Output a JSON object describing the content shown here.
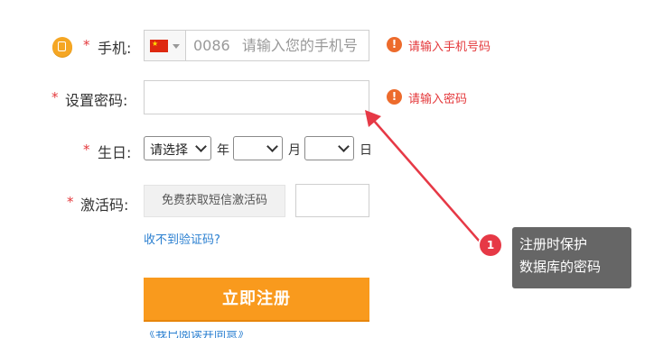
{
  "form": {
    "required_mark": "*",
    "phone": {
      "label": "手机:",
      "country_code": "0086",
      "placeholder": "请输入您的手机号",
      "error": "请输入手机号码",
      "error_icon": "!"
    },
    "password": {
      "label": "设置密码:",
      "error": "请输入密码",
      "error_icon": "!"
    },
    "birthday": {
      "label": "生日:",
      "year_select": "请选择",
      "year_unit": "年",
      "month_unit": "月",
      "day_unit": "日"
    },
    "activation": {
      "label": "激活码:",
      "get_code_button": "免费获取短信激活码",
      "no_code_link": "收不到验证码?"
    },
    "submit_label": "立即注册",
    "bottom_link_partial": "《我已阅读并同意》"
  },
  "annotation": {
    "badge_number": "1",
    "tooltip_line1": "注册时保护",
    "tooltip_line2": "数据库的密码",
    "arrow_color": "#e63946"
  },
  "colors": {
    "accent": "#f99a1d",
    "error": "#e4393c",
    "link": "#2a7fd0"
  }
}
